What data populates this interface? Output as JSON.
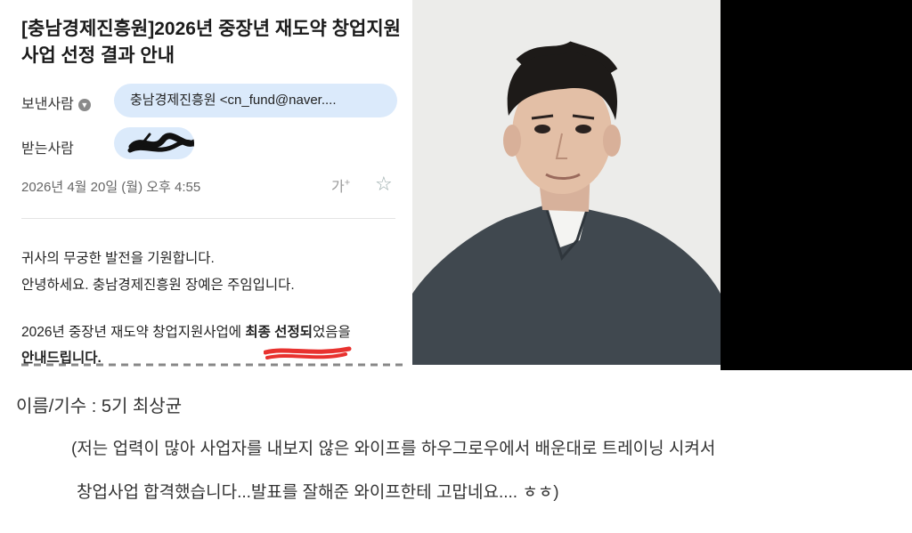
{
  "email": {
    "subject": "[충남경제진흥원]2026년 중장년 재도약 창업지원사업 선정 결과 안내",
    "sender_label": "보낸사람",
    "sender_value": "충남경제진흥원 <cn_fund@naver....",
    "recipient_label": "받는사람",
    "date": "2026년 4월 20일 (월) 오후 4:55",
    "font_size_icon_label": "가",
    "body": {
      "line1": "귀사의 무궁한 발전을 기원합니다.",
      "line2": "안녕하세요. 충남경제진흥원 장예은 주임입니다.",
      "line3_a": "2026년 중장년 재도약 창업지원사업에 ",
      "line3_b": "최종 선정되",
      "line3_c": "었음을",
      "line4": "안내드립니다."
    },
    "colors": {
      "chip": "#dbeafb",
      "scribble": "#e8322f",
      "redact": "#111111"
    }
  },
  "photo": {
    "description_icon": "person-photo"
  },
  "caption": {
    "name_line": "이름/기수 : 5기 최상균",
    "line1": "(저는 업력이 많아 사업자를 내보지 않은 와이프를  하우그로우에서 배운대로 트레이닝 시켜서",
    "line2": "창업사업 합격했습니다...발표를 잘해준 와이프한테 고맙네요.... ㅎㅎ)"
  }
}
